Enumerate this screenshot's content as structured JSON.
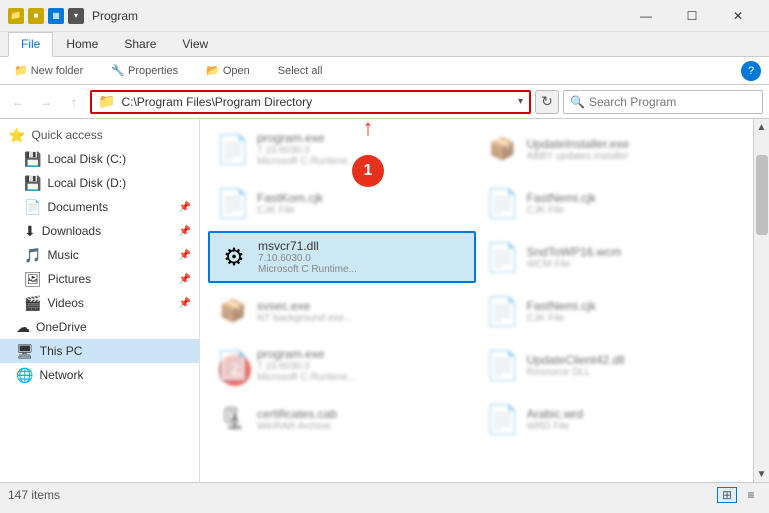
{
  "titleBar": {
    "title": "Program",
    "minimize": "—",
    "maximize": "☐",
    "close": "✕"
  },
  "ribbon": {
    "tabs": [
      "File",
      "Home",
      "Share",
      "View"
    ],
    "activeTab": "Home",
    "buttons": [
      "New folder",
      "Properties",
      "Open",
      "Select all"
    ]
  },
  "addressBar": {
    "path": "C:\\Program Files\\Program Directory",
    "pathIcon": "📁",
    "searchPlaceholder": "Search Program",
    "refreshIcon": "↻"
  },
  "sidebar": {
    "items": [
      {
        "id": "quick-access",
        "label": "Quick access",
        "icon": "⭐",
        "type": "section"
      },
      {
        "id": "local-disk-c",
        "label": "Local Disk (C:)",
        "icon": "💾"
      },
      {
        "id": "local-disk-d",
        "label": "Local Disk (D:)",
        "icon": "💾"
      },
      {
        "id": "documents",
        "label": "Documents",
        "icon": "📄",
        "pinned": true
      },
      {
        "id": "downloads",
        "label": "Downloads",
        "icon": "⬇",
        "pinned": true
      },
      {
        "id": "music",
        "label": "Music",
        "icon": "🎵",
        "pinned": true
      },
      {
        "id": "pictures",
        "label": "Pictures",
        "icon": "🖼",
        "pinned": true
      },
      {
        "id": "videos",
        "label": "Videos",
        "icon": "🎬",
        "pinned": true
      },
      {
        "id": "onedrive",
        "label": "OneDrive",
        "icon": "☁"
      },
      {
        "id": "this-pc",
        "label": "This PC",
        "icon": "🖥"
      },
      {
        "id": "network",
        "label": "Network",
        "icon": "🌐"
      }
    ]
  },
  "fileArea": {
    "files": [
      {
        "id": "program-exe",
        "name": "program.exe",
        "detail1": "7.10.6030.0",
        "detail2": "Microsoft C Runtime...",
        "icon": "📄",
        "blurred": true
      },
      {
        "id": "updateinstaller-exe",
        "name": "UpdateInstaller.exe",
        "detail1": "ABBY updates installer",
        "detail2": "",
        "icon": "📦",
        "blurred": true
      },
      {
        "id": "fastkom-cjk",
        "name": "FastKom.cjk",
        "detail1": "CJK File",
        "detail2": "",
        "icon": "📄",
        "blurred": true
      },
      {
        "id": "fastnemi-cjk",
        "name": "FastNemi.cjk",
        "detail1": "CJK File",
        "detail2": "",
        "icon": "📄",
        "blurred": true
      },
      {
        "id": "msvcr71-dll",
        "name": "msvcr71.dll",
        "detail1": "7.10.6030.0",
        "detail2": "Microsoft C Runtime...",
        "icon": "⚙",
        "selected": true
      },
      {
        "id": "sndfowp16-wcm",
        "name": "SndToWP16.wcm",
        "detail1": "WCM File",
        "detail2": "",
        "icon": "📄",
        "blurred": true
      },
      {
        "id": "svsec-exe",
        "name": "svsec.exe",
        "detail1": "NT background exe...",
        "detail2": "",
        "icon": "📦",
        "blurred": true
      },
      {
        "id": "fastnemi2-cjk",
        "name": "FastNemi.cjk",
        "detail1": "CJK File",
        "detail2": "",
        "icon": "📄",
        "blurred": true
      },
      {
        "id": "unknown-0",
        "name": "program.exe",
        "detail1": "7.10.6030.0",
        "detail2": "Microsoft C Runtime...",
        "icon": "📄",
        "blurred": true
      },
      {
        "id": "updateclient42-dll",
        "name": "UpdateClient42.dll",
        "detail1": "Resource DLL",
        "detail2": "",
        "icon": "📄",
        "blurred": true
      },
      {
        "id": "certificates-cab",
        "name": "certificates.cab",
        "detail1": "WinRAR Archive",
        "detail2": "",
        "icon": "🗜",
        "blurred": true
      },
      {
        "id": "arabic-wrd",
        "name": "Arabic.wrd",
        "detail1": "WRD File",
        "detail2": "",
        "icon": "📄",
        "blurred": true
      }
    ]
  },
  "statusBar": {
    "itemCount": "147 items"
  },
  "annotations": [
    {
      "id": "1",
      "label": "1"
    },
    {
      "id": "2",
      "label": "2"
    }
  ],
  "colors": {
    "accent": "#0078d7",
    "annotationRed": "#e8301e",
    "selectedBorder": "#cc0000",
    "activeSidebar": "#cce4f7"
  }
}
